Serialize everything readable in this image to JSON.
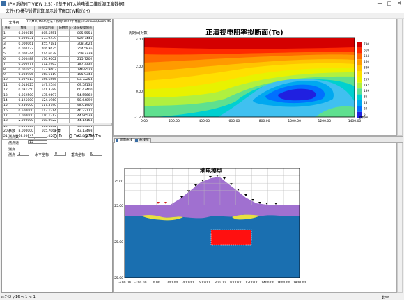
{
  "window": {
    "title": "IPM系统MT(VIEW 2.5) - [基于MT大地电磁二维反演正演数据]",
    "min": "—",
    "max": "□",
    "close": "✕"
  },
  "menu": [
    "文件(F)",
    "模型设置",
    "计算",
    "显示设置",
    "窗口(W)",
    "帮助(H)"
  ],
  "file": {
    "label": "文件名",
    "path": "D:\\MT\\DATA\\电法工作站\\2022年数据\\inversion\\demo.dat"
  },
  "table": {
    "headers": [
      "序号",
      "频率",
      "Te视电阻率",
      "Te相位",
      "正演Te视电阻率"
    ],
    "rows": [
      [
        "1",
        "0.000015",
        "805.5551",
        "",
        "805.5551"
      ],
      [
        "2",
        "0.000031",
        "573.9439",
        "",
        "529.7441"
      ],
      [
        "3",
        "0.000061",
        "355.7181",
        "",
        "308.3624"
      ],
      [
        "4",
        "0.000122",
        "206.9675",
        "",
        "254.5836"
      ],
      [
        "5",
        "0.000244",
        "214.6078",
        "",
        "259.7339"
      ],
      [
        "6",
        "0.000488",
        "176.9002",
        "",
        "215.7202"
      ],
      [
        "7",
        "0.000977",
        "172.2965",
        "",
        "187.3332"
      ],
      [
        "8",
        "0.001953",
        "177.9603",
        "",
        "146.8528"
      ],
      [
        "9",
        "0.003906",
        "168.6119",
        "",
        "105.9343"
      ],
      [
        "10",
        "0.007813",
        "156.6566",
        "",
        "83.72254"
      ],
      [
        "11",
        "0.015625",
        "147.2544",
        "",
        "69.58135"
      ],
      [
        "12",
        "0.031250",
        "141.3789",
        "",
        "60.47400"
      ],
      [
        "13",
        "0.062500",
        "135.9697",
        "",
        "54.55669"
      ],
      [
        "14",
        "0.125000",
        "124.1960",
        "",
        "50.64099"
      ],
      [
        "15",
        "0.250000",
        "117.5790",
        "",
        "48.01900"
      ],
      [
        "16",
        "0.500000",
        "113.1214",
        "",
        "46.22171"
      ],
      [
        "17",
        "1.000000",
        "110.1312",
        "",
        "44.96533"
      ],
      [
        "18",
        "2.000000",
        "108.0922",
        "",
        "44.14163"
      ],
      [
        "19",
        "4.000000",
        "106.6852",
        "",
        "43.54091"
      ],
      [
        "20",
        "8.000000",
        "105.7061",
        "",
        "43.13498"
      ],
      [
        "21",
        "16.00000",
        "105.0206",
        "",
        "42.84277"
      ]
    ]
  },
  "params": {
    "header": "参数",
    "station_count_label": "测点数",
    "station_count": "21",
    "layer_label": "测点道",
    "layer_value": "15",
    "calc_label": "计算",
    "radios": [
      {
        "label": "Te",
        "on": false
      },
      {
        "label": "Tm",
        "on": false
      },
      {
        "label": "TeNTm",
        "on": true
      }
    ],
    "section_label": "测点",
    "from_label": "测点",
    "from_value": "1",
    "h_label": "水平坐标",
    "h_value": "0",
    "v_label": "垂向坐标",
    "v_value": "0"
  },
  "top_chart": {
    "title": "正演视电阻率拟断面(Te)",
    "ylabel": "周期(s)对数",
    "y_ticks": [
      "4.00",
      "2.00",
      "0.00",
      "-1.20"
    ],
    "x_ticks": [
      "0.00",
      "200.00",
      "400.00",
      "600.00",
      "800.00",
      "1000.00",
      "1200.00",
      "1400.00"
    ],
    "legend_values": [
      "730",
      "610",
      "534",
      "460",
      "389",
      "319",
      "259",
      "197",
      "139",
      "86",
      "48",
      "20",
      "5"
    ],
    "legend_unit": "欧姆m",
    "colors": [
      "#d40000",
      "#ff2a00",
      "#ff6a00",
      "#ff9a00",
      "#ffc400",
      "#ffe000",
      "#e8f200",
      "#b0f040",
      "#5fe08f",
      "#00d0d0",
      "#00a8f0",
      "#0070ff",
      "#2020e0"
    ]
  },
  "tabs": [
    {
      "label": "断面曲线"
    },
    {
      "label": "曲线图"
    }
  ],
  "bottom_chart": {
    "title": "地电模型",
    "y_ticks": [
      "75.00",
      "-25.00",
      "-125.00",
      "-225.00"
    ],
    "x_ticks": [
      "-400.00",
      "-200.00",
      "0.00",
      "200.00",
      "400.00",
      "600.00",
      "800.00",
      "1000.00",
      "1200.00",
      "1400.00",
      "1600.00",
      "1800.00"
    ],
    "colors": {
      "topo": "#a070d0",
      "layer": "#e8e040",
      "basement": "#1a6fb0",
      "anomaly": "#ff1010"
    }
  },
  "status": {
    "left": "x:742 y:16 v:-1 n:-1",
    "right": "数字"
  }
}
